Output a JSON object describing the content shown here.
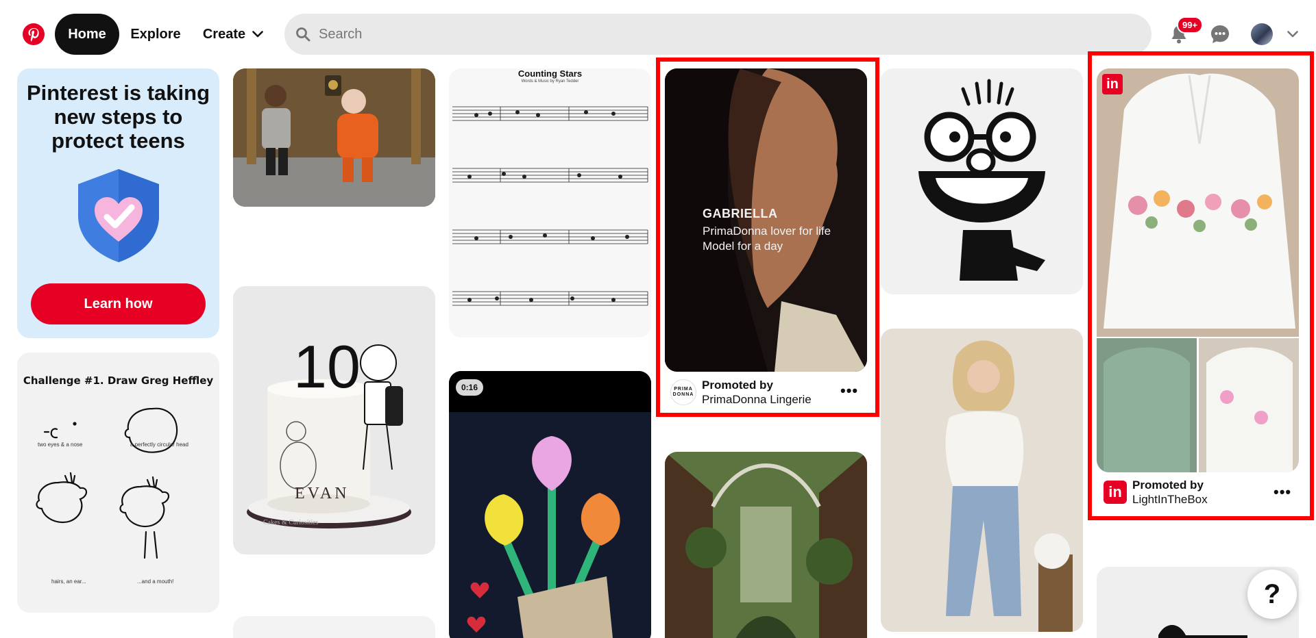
{
  "header": {
    "home_label": "Home",
    "explore_label": "Explore",
    "create_label": "Create",
    "search_placeholder": "Search",
    "notifications_badge": "99+"
  },
  "pins": {
    "promo": {
      "title": "Pinterest is taking new steps to protect teens",
      "button_label": "Learn how"
    },
    "greg": {
      "title": "Challenge #1. Draw Greg Heffley",
      "captions": [
        "two eyes & a nose",
        "a perfectly circular head",
        "hairs, an ear...",
        "...and a mouth!"
      ]
    },
    "cake": {
      "topper": "10",
      "name": "EVAN",
      "watermark": "Cakes & Curiosities"
    },
    "music": {
      "title": "Counting Stars",
      "subtitle": "Words & Music by Ryan Tedder"
    },
    "flowers": {
      "duration": "0:16"
    },
    "gabriella": {
      "name": "GABRIELLA",
      "line1": "PrimaDonna lover for life",
      "line2": "Model for a day",
      "promoted_by": "Promoted by",
      "advertiser": "PrimaDonna Lingerie",
      "logo_text": "PRIMA DONNA"
    },
    "blouse": {
      "brand_tag": "in",
      "promoted_by": "Promoted by",
      "advertiser": "LightInTheBox"
    }
  },
  "help_label": "?",
  "colors": {
    "brand": "#e60023",
    "highlight": "#ff0000",
    "promo_bg": "#d9ecfb",
    "search_bg": "#e9e9e9"
  },
  "icons": [
    "pinterest-logo-icon",
    "chevron-down-icon",
    "search-icon",
    "bell-icon",
    "chat-icon",
    "more-dots-icon"
  ]
}
